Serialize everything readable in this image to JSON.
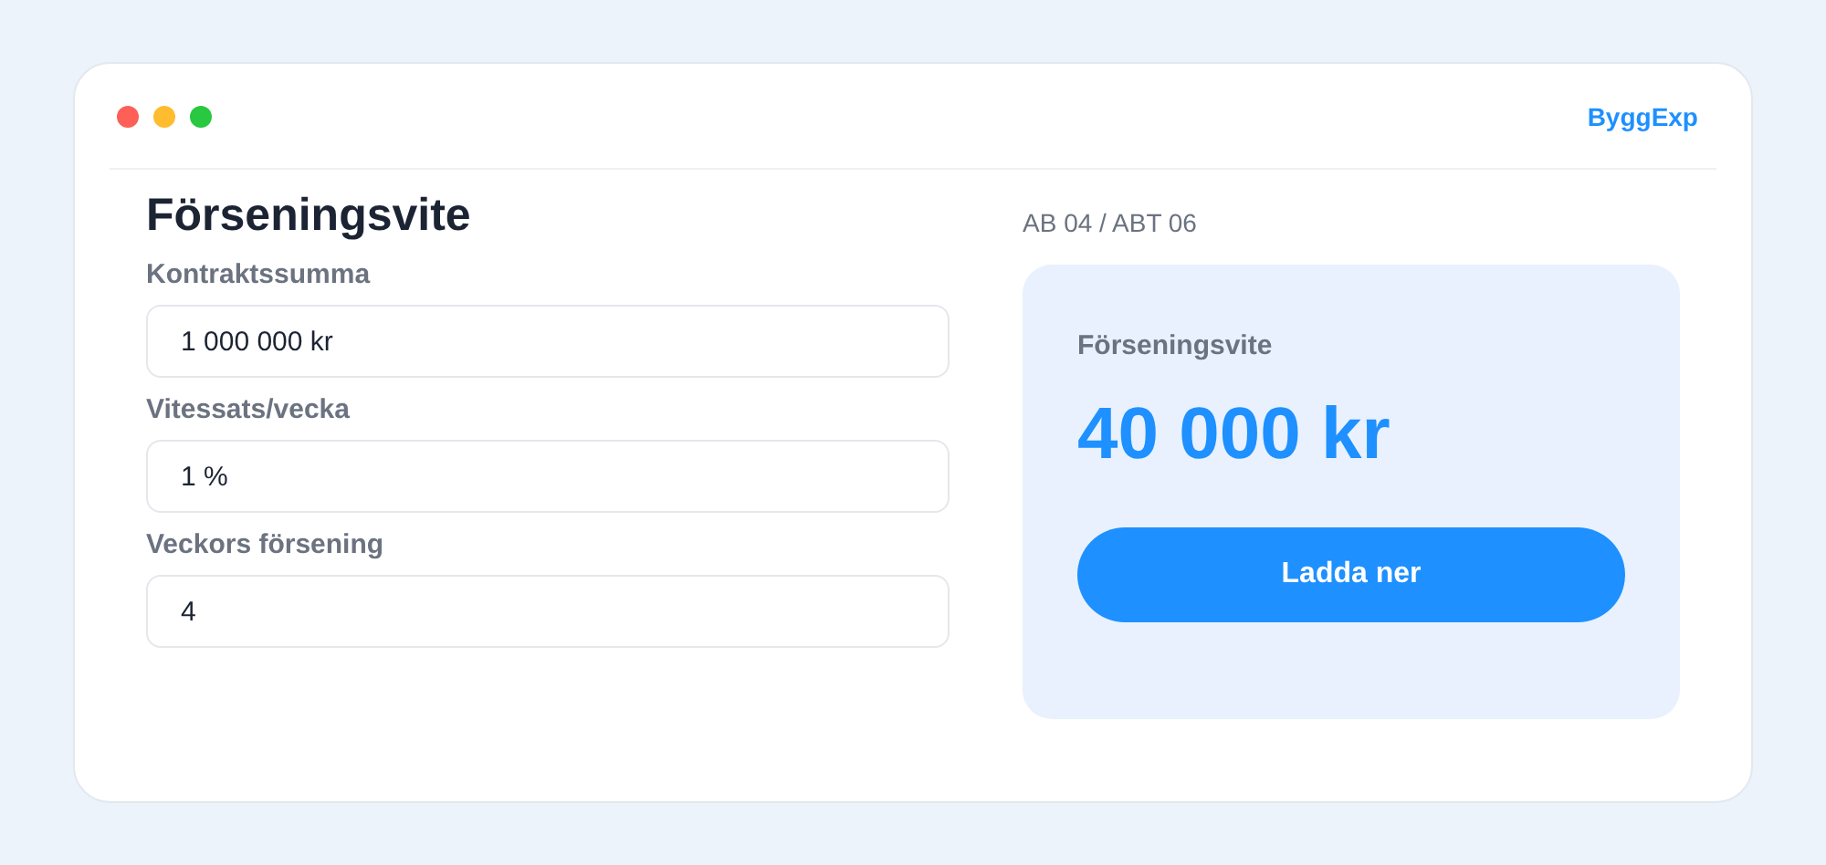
{
  "window": {
    "brand": "ByggExp"
  },
  "form": {
    "title": "Förseningsvite",
    "fields": [
      {
        "label": "Kontraktssumma",
        "value": "1 000 000 kr"
      },
      {
        "label": "Vitessats/vecka",
        "value": "1 %"
      },
      {
        "label": "Veckors försening",
        "value": "4"
      }
    ]
  },
  "result": {
    "caption": "AB 04 / ABT 06",
    "label": "Förseningsvite",
    "value": "40 000 kr",
    "button": "Ladda ner"
  }
}
